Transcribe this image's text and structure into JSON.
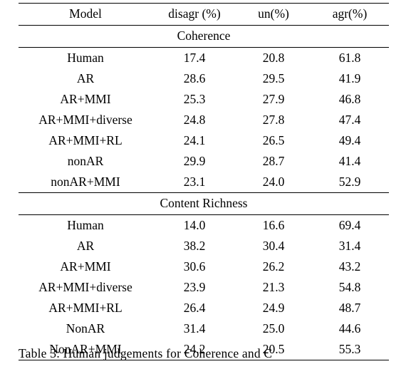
{
  "table": {
    "columns": [
      "Model",
      "disagr (%)",
      "un(%)",
      "agr(%)"
    ],
    "sections": [
      {
        "title": "Coherence",
        "rows": [
          {
            "model": "Human",
            "disagr": "17.4",
            "un": "20.8",
            "agr": "61.8"
          },
          {
            "model": "AR",
            "disagr": "28.6",
            "un": "29.5",
            "agr": "41.9"
          },
          {
            "model": "AR+MMI",
            "disagr": "25.3",
            "un": "27.9",
            "agr": "46.8"
          },
          {
            "model": "AR+MMI+diverse",
            "disagr": "24.8",
            "un": "27.8",
            "agr": "47.4"
          },
          {
            "model": "AR+MMI+RL",
            "disagr": "24.1",
            "un": "26.5",
            "agr": "49.4"
          },
          {
            "model": "nonAR",
            "disagr": "29.9",
            "un": "28.7",
            "agr": "41.4"
          },
          {
            "model": "nonAR+MMI",
            "disagr": "23.1",
            "un": "24.0",
            "agr": "52.9"
          }
        ]
      },
      {
        "title": "Content Richness",
        "rows": [
          {
            "model": "Human",
            "disagr": "14.0",
            "un": "16.6",
            "agr": "69.4"
          },
          {
            "model": "AR",
            "disagr": "38.2",
            "un": "30.4",
            "agr": "31.4"
          },
          {
            "model": "AR+MMI",
            "disagr": "30.6",
            "un": "26.2",
            "agr": "43.2"
          },
          {
            "model": "AR+MMI+diverse",
            "disagr": "23.9",
            "un": "21.3",
            "agr": "54.8"
          },
          {
            "model": "AR+MMI+RL",
            "disagr": "26.4",
            "un": "24.9",
            "agr": "48.7"
          },
          {
            "model": "NonAR",
            "disagr": "31.4",
            "un": "25.0",
            "agr": "44.6"
          },
          {
            "model": "NonAR+MMI",
            "disagr": "24.2",
            "un": "20.5",
            "agr": "55.3"
          }
        ]
      }
    ]
  },
  "caption": {
    "text": "Table 3:   Human judgements for Coherence and C"
  }
}
